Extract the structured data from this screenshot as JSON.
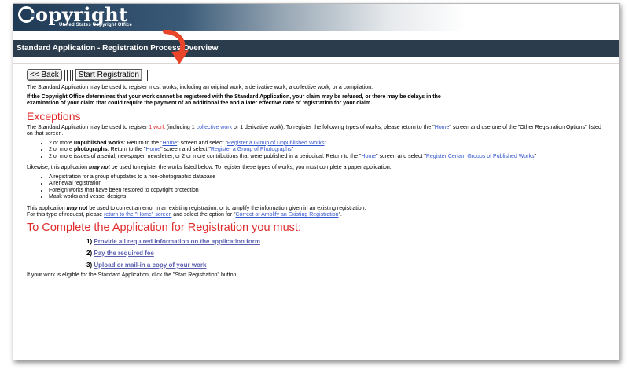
{
  "banner": {
    "logo_text": "opyright",
    "logo_subtext": "United States Copyright Office"
  },
  "title_bar": "Standard Application - Registration Process Overview",
  "buttons": {
    "back": "<< Back",
    "start": "Start Registration"
  },
  "intro": {
    "line1": "The Standard Application may be used to register most works, including an original work, a derivative work, a collective work, or a compilation.",
    "bold_warning": "If the Copyright Office determines that your work cannot be registered with the Standard Application, your claim may be refused, or there may be delays in the examination of your claim that could require the payment of an additional fee and a later effective date of registration for your claim."
  },
  "exceptions": {
    "heading": "Exceptions",
    "p1_a": "The Standard Application may be used to register ",
    "p1_red": "1 work",
    "p1_b": " (including 1 ",
    "p1_link": "collective work",
    "p1_c": " or 1 derivative work). To register the following types of works, please return to the \"",
    "p1_home": "Home",
    "p1_d": "\" screen and use one of the \"Other Registration Options\" listed on that screen.",
    "bullets": [
      {
        "pre": "2 or more ",
        "bold": "unpublished works",
        "mid": ": Return to the \"",
        "home": "Home",
        "mid2": "\" screen and select \"",
        "link": "Register a Group of Unpublished Works",
        "post": "\""
      },
      {
        "pre": "2 or more ",
        "bold": "photographs",
        "mid": ": Return to the \"",
        "home": "Home",
        "mid2": "\" screen and select \"",
        "link": "Register a Group of Photographs",
        "post": "\""
      },
      {
        "pre": "2 or more issues of a serial, newspaper, newsletter, or 2 or more contributions that were published in a periodical: Return to the \"",
        "bold": "",
        "mid": "",
        "home": "Home",
        "mid2": "\" screen and select \"",
        "link": "Register Certain Groups of Published Works",
        "post": "\""
      }
    ],
    "p2_a": "Likewise, this application ",
    "p2_bi": "may not",
    "p2_b": " be used to register the works listed below. To register these types of works, you must complete a paper application.",
    "list2": [
      "A registration for a group of updates to a non-photographic database",
      "A renewal registration",
      "Foreign works that have been restored to copyright protection",
      "Mask works and vessel designs"
    ],
    "p3_a": "This application ",
    "p3_bi": "may not",
    "p3_b": " be used to correct an error in an existing registration, or to amplify the information given in an existing registration.",
    "p3_c": "For this type of request, please ",
    "p3_link1": "return to the \"Home\" screen",
    "p3_d": " and select the option for \"",
    "p3_link2": "Correct or Amplify an Existing Registration",
    "p3_e": "\"."
  },
  "complete": {
    "heading": "To Complete the Application for Registration you must:",
    "steps": [
      {
        "num": "1)",
        "text": "Provide all required information on the application form"
      },
      {
        "num": "2)",
        "text": "Pay the required fee"
      },
      {
        "num": "3)",
        "text": "Upload or mail-in a copy of your work"
      }
    ],
    "footer": "If your work is eligible for the Standard Application, click the \"Start Registration\" button."
  },
  "colors": {
    "accent_red": "#e02a2a",
    "title_bar": "#2b3d4d",
    "arrow": "#e8452a"
  }
}
